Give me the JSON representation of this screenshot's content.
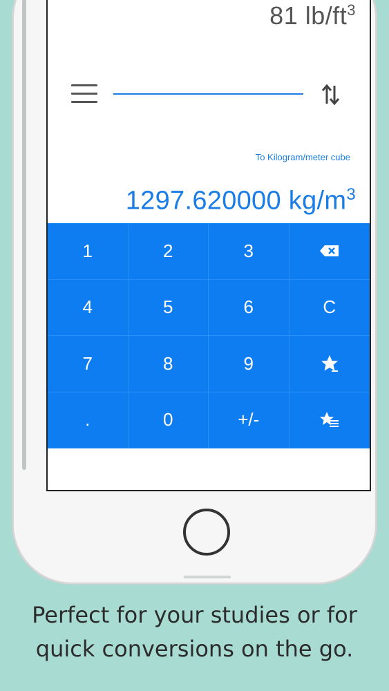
{
  "converter": {
    "from_value": "81 lb/ft",
    "from_superscript": "3",
    "to_label": "To Kilogram/meter cube",
    "to_value": "1297.620000 kg/m",
    "to_superscript": "3"
  },
  "keypad": {
    "keys": [
      "1",
      "2",
      "3",
      "",
      "4",
      "5",
      "6",
      "C",
      "7",
      "8",
      "9",
      "",
      ".",
      "0",
      "+/-",
      ""
    ],
    "icons": {
      "backspace": "backspace-icon",
      "favorite": "star-icon",
      "favorites_list": "star-list-icon"
    }
  },
  "caption": {
    "line1": "Perfect for your studies or for",
    "line2": "quick conversions on the go."
  },
  "colors": {
    "accent": "#0f7df2",
    "background": "#a8dcd3"
  }
}
